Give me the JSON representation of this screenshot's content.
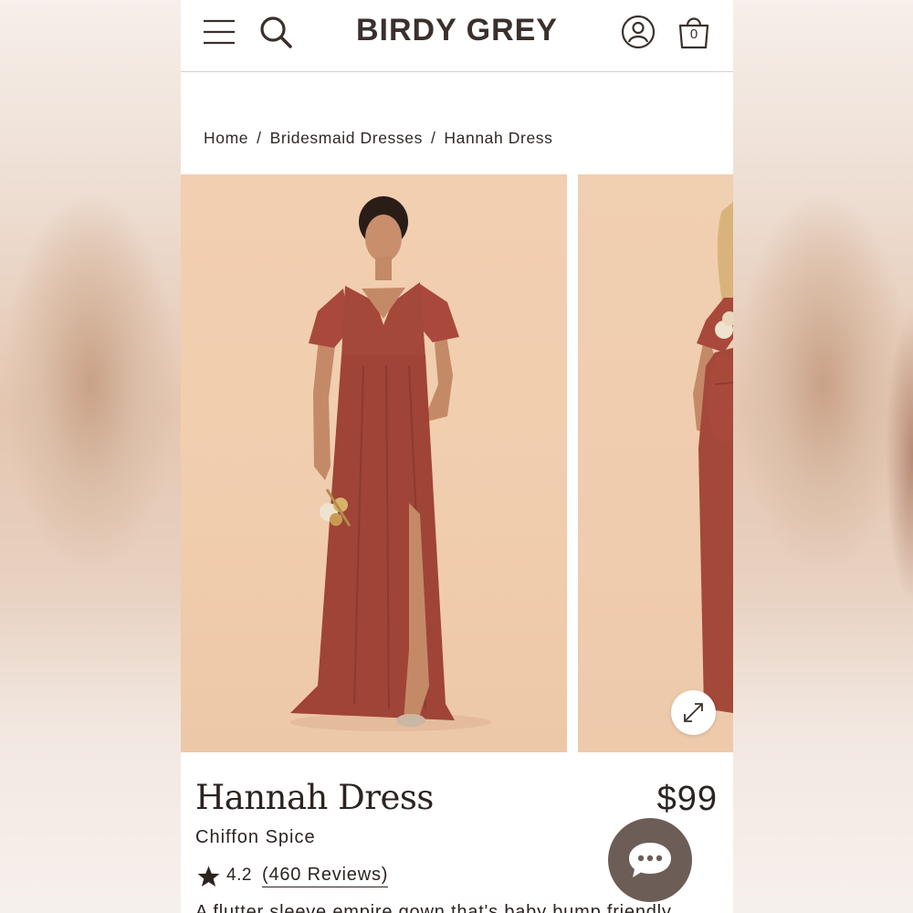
{
  "header": {
    "brand": "BIRDY GREY",
    "cart_count": "0",
    "icons": [
      "menu-icon",
      "search-icon",
      "account-icon",
      "shopping-bag-icon"
    ]
  },
  "breadcrumb": {
    "items": [
      "Home",
      "Bridesmaid Dresses",
      "Hannah Dress"
    ],
    "separator": "/"
  },
  "gallery": {
    "expand_icon": "expand-arrows-icon"
  },
  "product": {
    "title": "Hannah Dress",
    "price": "$99",
    "variant": "Chiffon Spice",
    "rating": "4.2",
    "reviews_label": "(460 Reviews)",
    "description": "A flutter sleeve empire gown that's baby bump friendly"
  },
  "chat": {
    "icon": "chat-bubble-icon"
  },
  "colors": {
    "brand_text": "#3a302c",
    "dress": "#a4483a",
    "backdrop": "#f0cdad",
    "chat_button": "#6d5d57"
  }
}
